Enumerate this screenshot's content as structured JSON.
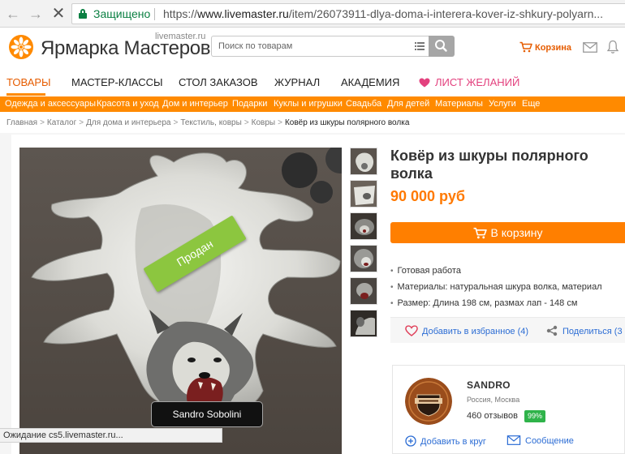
{
  "browser": {
    "secure_label": "Защищено",
    "url_scheme": "https://",
    "url_host": "www.livemaster.ru",
    "url_path": "/item/26073911-dlya-doma-i-interera-kover-iz-shkury-polyarn..."
  },
  "header": {
    "logo_text": "Ярмарка Мастеров",
    "logo_domain": "livemaster.ru",
    "search_placeholder": "Поиск по товарам",
    "cart_label": "Корзина"
  },
  "main_menu": {
    "items": [
      "ТОВАРЫ",
      "МАСТЕР-КЛАССЫ",
      "СТОЛ ЗАКАЗОВ",
      "ЖУРНАЛ",
      "АКАДЕМИЯ"
    ],
    "wishlist": "ЛИСТ ЖЕЛАНИЙ",
    "active_index": 0
  },
  "categories": [
    "Одежда и аксессуары",
    "Красота и уход",
    "Дом и интерьер",
    "Подарки",
    "Куклы и игрушки",
    "Свадьба",
    "Для детей",
    "Материалы",
    "Услуги",
    "Еще"
  ],
  "breadcrumbs": [
    "Главная",
    "Каталог",
    "Для дома и интерьера",
    "Текстиль, ковры",
    "Ковры",
    "Ковёр из шкуры полярного волка"
  ],
  "product": {
    "title": "Ковёр из шкуры полярного волка",
    "price": "90 000 руб",
    "sold_label": "Продан",
    "author_tag": "Sandro Sobolini",
    "buy_button": "В корзину",
    "specs": [
      "Готовая работа",
      "Материалы:  натуральная шкура волка, материал",
      "Размер: Длина 198 см, размах лап - 148 см"
    ],
    "add_favorite": "Добавить в избранное (4)",
    "share": "Поделиться (3"
  },
  "seller": {
    "name": "SANDRO",
    "location": "Россия, Москва",
    "reviews": "460 отзывов",
    "rating_badge": "99%",
    "add_to_circle": "Добавить в круг",
    "message": "Сообщение"
  },
  "status_bar": "Ожидание cs5.livemaster.ru...",
  "colors": {
    "accent_orange": "#ff8a00",
    "price_orange": "#ff7900",
    "link_blue": "#2b6cd4",
    "secure_green": "#0b8043",
    "wishlist_pink": "#e3417e",
    "badge_green": "#2fb34a",
    "sold_ribbon_green": "#8cc63f"
  }
}
